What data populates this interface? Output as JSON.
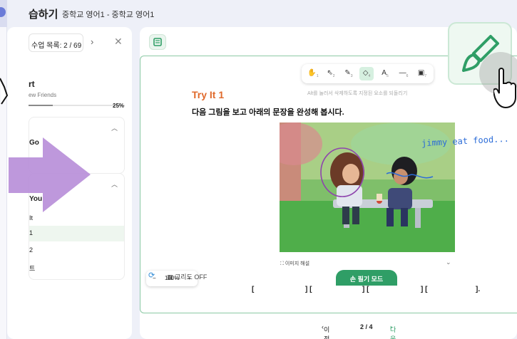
{
  "header": {
    "title": "습하기",
    "breadcrumb": "중학교 영어1 - 중학교 영어1"
  },
  "sidebar": {
    "list_label": "수업 목록: 2 / 69",
    "unit_title": "rt",
    "unit_subtitle": "ew Friends",
    "progress_label": "25%",
    "progress_value": 0.25,
    "section1_title": "Go",
    "section2_title": "You",
    "lessons": [
      "It",
      "1",
      "2",
      "트"
    ]
  },
  "toolbar": {
    "tools": [
      {
        "icon": "hand-icon",
        "glyph": "✋",
        "key": "1"
      },
      {
        "icon": "pointer-icon",
        "glyph": "⇖",
        "key": "2"
      },
      {
        "icon": "pen-icon",
        "glyph": "✎",
        "key": "3"
      },
      {
        "icon": "eraser-icon",
        "glyph": "◇",
        "key": "4"
      },
      {
        "icon": "text-icon",
        "glyph": "A",
        "key": "5"
      },
      {
        "icon": "line-icon",
        "glyph": "—",
        "key": "6"
      },
      {
        "icon": "image-icon",
        "glyph": "▣",
        "key": "7"
      }
    ],
    "active_tool": "eraser-icon",
    "hint": "Alt를 눌러서 삭제하도록 지정된 요소를 되돌리기"
  },
  "content": {
    "title": "Try It 1",
    "instruction": "다음 그림을 보고 아래의 문장을 완성해 봅시다.",
    "handwriting": "jimmy eat food...",
    "image_caption": "이미지 해설",
    "brackets": [
      "[",
      "] [",
      "] [",
      "] [",
      "]."
    ]
  },
  "zoom": {
    "minus": "−",
    "value": "100%",
    "plus": "+"
  },
  "footer": {
    "grid_label": "그리드 OFF",
    "hand_mode": "손 필기 모드",
    "prev": "이전",
    "page": "2 / 4",
    "next": "다음"
  },
  "colors": {
    "accent_green": "#2f9e66",
    "title_orange": "#e06a2c",
    "arrow_purple": "#b98fd9",
    "handwriting_blue": "#2b6cd8"
  }
}
